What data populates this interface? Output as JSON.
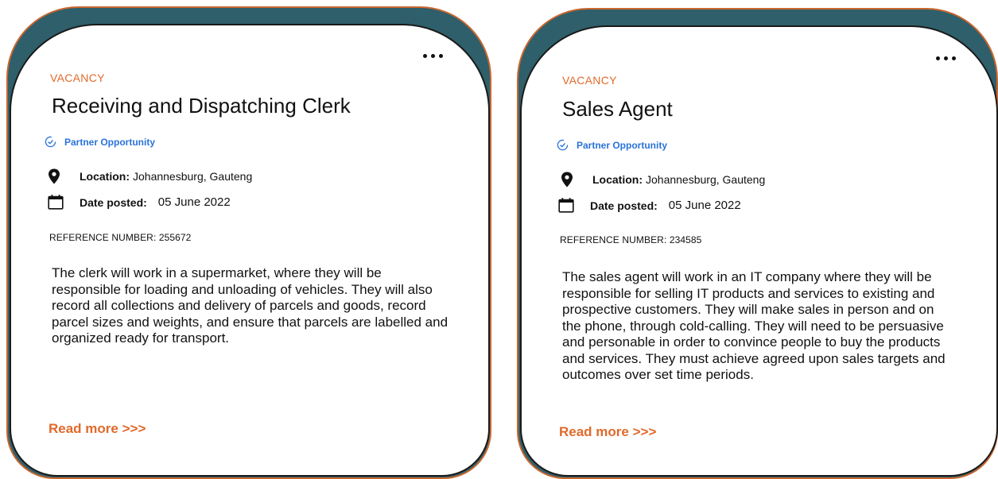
{
  "colors": {
    "accent": "#e06a2c",
    "teal": "#2e5f6a",
    "link_blue": "#2a73d9"
  },
  "cards": [
    {
      "menu_icon": "more-horizontal-icon",
      "kicker": "VACANCY",
      "title": "Receiving and Dispatching Clerk",
      "badge": "Partner Opportunity",
      "location_label": "Location:",
      "location_value": " Johannesburg, Gauteng",
      "date_label": "Date posted:",
      "date_value": "05 June 2022",
      "reference": "REFERENCE NUMBER: 255672",
      "description": "The clerk will work in a supermarket, where they will be responsible for loading and unloading of vehicles. They will also record all collections and delivery of parcels and goods, record parcel sizes and weights, and ensure that parcels are labelled and organized ready for transport.",
      "read_more": "Read more  >>>"
    },
    {
      "menu_icon": "more-horizontal-icon",
      "kicker": "VACANCY",
      "title": "Sales Agent",
      "badge": "Partner Opportunity",
      "location_label": "Location:",
      "location_value": " Johannesburg, Gauteng",
      "date_label": "Date posted:",
      "date_value": "05 June 2022",
      "reference": "REFERENCE NUMBER: 234585",
      "description": "The sales agent will work in an IT company where they will be responsible for selling IT products and services to existing and prospective customers. They will make sales in person and on the phone, through cold-calling. They will need to be persuasive and personable in order to convince people to buy the products and services. They must achieve agreed upon sales targets and outcomes over set time periods.",
      "read_more": "Read more  >>>"
    }
  ]
}
